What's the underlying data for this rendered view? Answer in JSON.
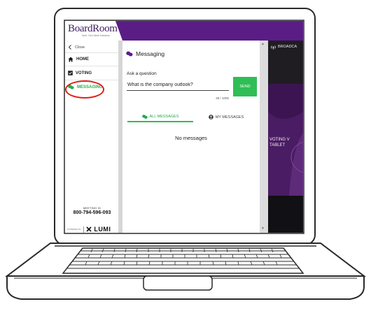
{
  "app": {
    "brand_name": "BoardRoom",
    "tagline": "Next. Gen Meet Solutions"
  },
  "sidebar": {
    "close_label": "Close",
    "items": [
      {
        "label": "HOME",
        "icon": "home-icon"
      },
      {
        "label": "VOTING",
        "icon": "ballot-icon"
      },
      {
        "label": "MESSAGING",
        "icon": "chat-bubbles-icon"
      }
    ],
    "meeting_id_label": "MEETING ID",
    "meeting_id": "800-794-596-093",
    "powered_by": "POWERED BY",
    "provider": "LUMI"
  },
  "messaging": {
    "title": "Messaging",
    "ask_label": "Ask a question",
    "question_value": "What is the company outlook?",
    "char_count": "28 / 1000",
    "send_label": "SEND",
    "tabs": [
      {
        "label": "ALL MESSAGES",
        "active": true
      },
      {
        "label": "MY MESSAGES",
        "active": false
      }
    ],
    "empty_text": "No messages"
  },
  "broadcast": {
    "header_label": "BROADCA",
    "video_text_line1": "VOTING V",
    "video_text_line2": "TABLET"
  },
  "colors": {
    "accent_green": "#2fbe55",
    "brand_purple": "#5a1d86",
    "highlight_red": "#e0201b"
  }
}
